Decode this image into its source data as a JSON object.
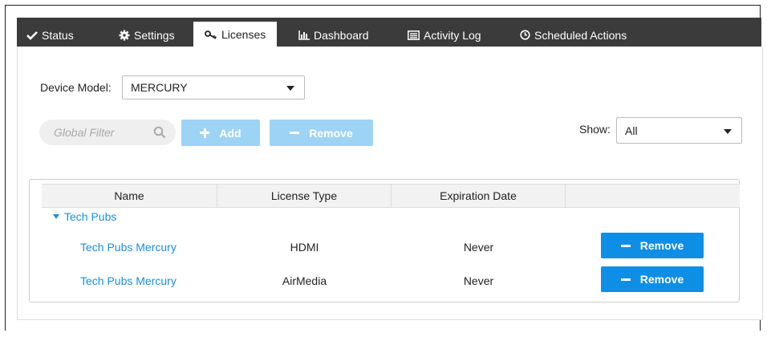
{
  "tabs": [
    {
      "label": "Status",
      "icon": "check-icon"
    },
    {
      "label": "Settings",
      "icon": "gear-icon"
    },
    {
      "label": "Licenses",
      "icon": "key-icon",
      "active": true
    },
    {
      "label": "Dashboard",
      "icon": "bar-chart-icon"
    },
    {
      "label": "Activity Log",
      "icon": "list-icon"
    },
    {
      "label": "Scheduled Actions",
      "icon": "clock-icon"
    }
  ],
  "device_model": {
    "label": "Device Model:",
    "value": "MERCURY"
  },
  "filter": {
    "placeholder": "Global Filter"
  },
  "toolbar": {
    "add_label": "Add",
    "remove_label": "Remove"
  },
  "show": {
    "label": "Show:",
    "value": "All"
  },
  "table": {
    "columns": [
      "Name",
      "License Type",
      "Expiration Date",
      ""
    ],
    "group": "Tech Pubs",
    "rows": [
      {
        "name": "Tech Pubs Mercury",
        "type": "HDMI",
        "expiration": "Never",
        "action": "Remove"
      },
      {
        "name": "Tech Pubs Mercury",
        "type": "AirMedia",
        "expiration": "Never",
        "action": "Remove"
      }
    ]
  },
  "colors": {
    "tabbar": "#3b3b3b",
    "accent": "#0f8ee6",
    "accent_disabled": "#9dd3f5",
    "link": "#1a8fe0"
  }
}
